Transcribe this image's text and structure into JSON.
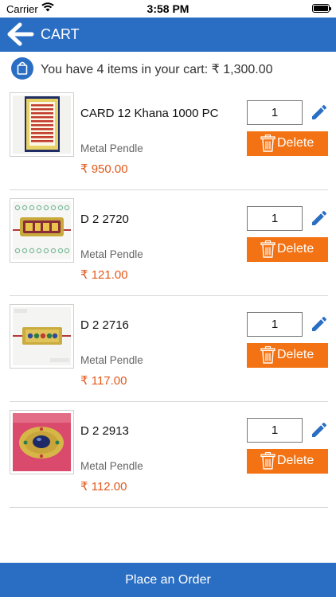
{
  "status_bar": {
    "carrier": "Carrier",
    "time": "3:58 PM"
  },
  "header": {
    "title": "CART"
  },
  "summary": {
    "text": "You have 4 items in your cart: ₹ 1,300.00"
  },
  "items": [
    {
      "name": "CARD 12 Khana 1000 PC",
      "category": "Metal Pendle",
      "price": "₹ 950.00",
      "quantity": "1",
      "delete_label": "Delete"
    },
    {
      "name": "D  2  2720",
      "category": "Metal Pendle",
      "price": "₹ 121.00",
      "quantity": "1",
      "delete_label": "Delete"
    },
    {
      "name": "D  2  2716",
      "category": "Metal Pendle",
      "price": "₹ 117.00",
      "quantity": "1",
      "delete_label": "Delete"
    },
    {
      "name": "D  2  2913",
      "category": "Metal Pendle",
      "price": "₹ 112.00",
      "quantity": "1",
      "delete_label": "Delete"
    }
  ],
  "footer": {
    "order_label": "Place an Order"
  },
  "colors": {
    "primary": "#2a6ec3",
    "accent": "#f37314",
    "price": "#e2581a"
  }
}
